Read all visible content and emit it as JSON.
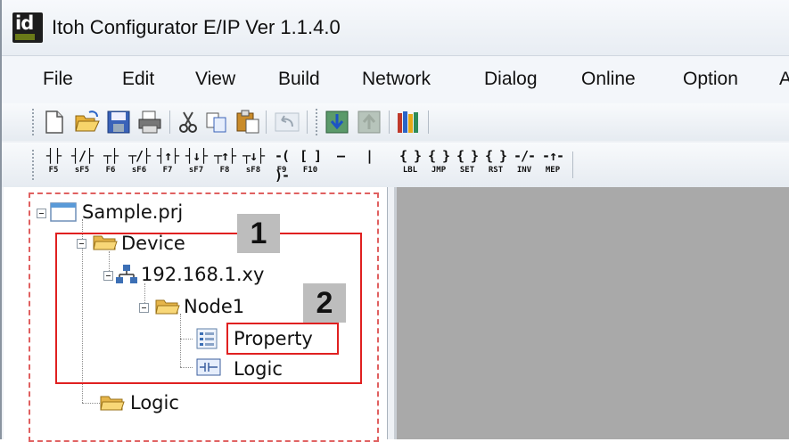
{
  "window": {
    "title": "Itoh Configurator E/IP Ver 1.1.4.0",
    "icon_name": "app-logo-icon"
  },
  "menu": [
    "File",
    "Edit",
    "View",
    "Build",
    "Network",
    "Dialog",
    "Online",
    "Option",
    "A"
  ],
  "toolbar1": [
    "new-file-icon",
    "open-folder-icon",
    "save-icon",
    "print-icon",
    "cut-icon",
    "copy-icon",
    "paste-icon",
    "undo-icon",
    "download-icon",
    "upload-icon",
    "library-icon"
  ],
  "toolbar2": [
    {
      "icon": "contact-no-icon",
      "key": "F5"
    },
    {
      "icon": "contact-nc-icon",
      "key": "sF5"
    },
    {
      "icon": "contact-no-parallel-icon",
      "key": "F6"
    },
    {
      "icon": "contact-nc-parallel-icon",
      "key": "sF6"
    },
    {
      "icon": "contact-rise-icon",
      "key": "F7"
    },
    {
      "icon": "contact-fall-icon",
      "key": "sF7"
    },
    {
      "icon": "contact-rise-parallel-icon",
      "key": "F8"
    },
    {
      "icon": "contact-fall-parallel-icon",
      "key": "sF8"
    },
    {
      "icon": "coil-icon",
      "key": "F9"
    },
    {
      "icon": "function-block-icon",
      "key": "F10"
    },
    {
      "icon": "horizontal-line-icon",
      "key": ""
    },
    {
      "icon": "vertical-line-icon",
      "key": ""
    },
    {
      "icon": "label-icon",
      "key": "LBL"
    },
    {
      "icon": "jump-icon",
      "key": "JMP"
    },
    {
      "icon": "set-icon",
      "key": "SET"
    },
    {
      "icon": "reset-icon",
      "key": "RST"
    },
    {
      "icon": "invert-icon",
      "key": "INV"
    },
    {
      "icon": "mep-icon",
      "key": "MEP"
    }
  ],
  "tree": {
    "project": "Sample.prj",
    "device": "Device",
    "ip": "192.168.1.xy",
    "node": "Node1",
    "property": "Property",
    "node_logic": "Logic",
    "logic": "Logic"
  },
  "callouts": {
    "one": "1",
    "two": "2"
  },
  "colors": {
    "callout_border": "#e02020",
    "frame_dash": "#e06060",
    "workspace": "#a9a9a9"
  }
}
